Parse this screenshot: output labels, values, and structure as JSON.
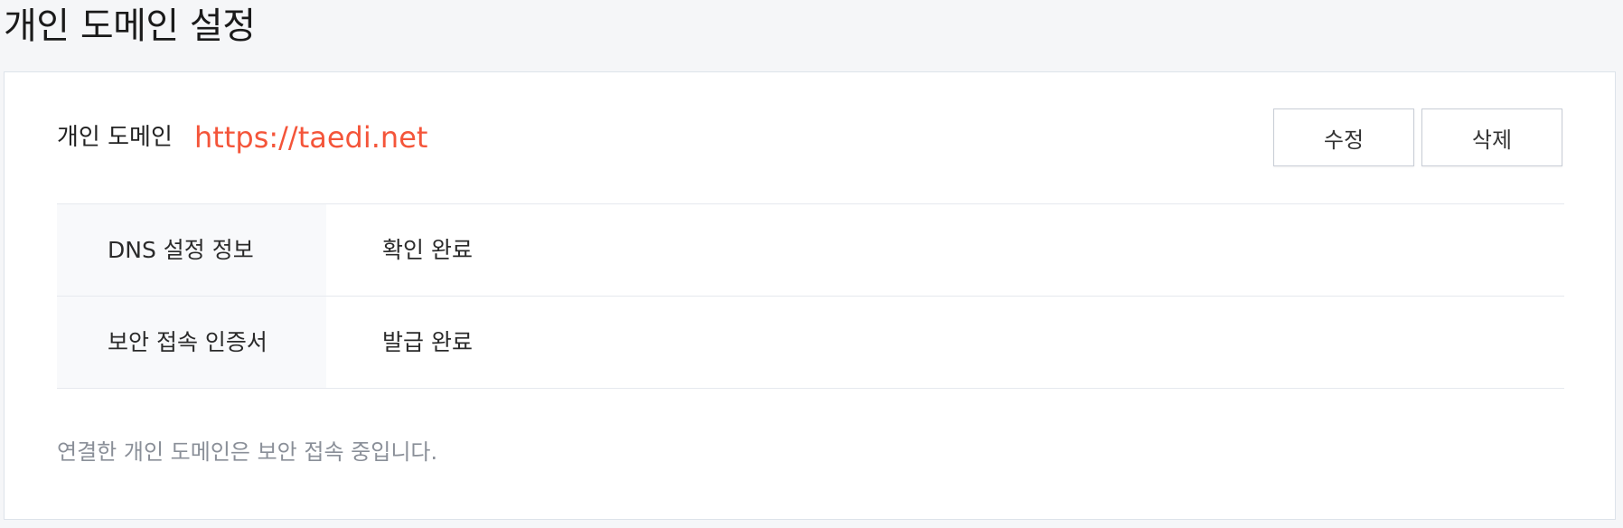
{
  "page": {
    "title": "개인 도메인 설정"
  },
  "domain": {
    "label": "개인 도메인",
    "url": "https://taedi.net",
    "url_color": "#f4553a"
  },
  "actions": {
    "edit_label": "수정",
    "delete_label": "삭제"
  },
  "info_rows": [
    {
      "label": "DNS 설정 정보",
      "value": "확인 완료"
    },
    {
      "label": "보안 접속 인증서",
      "value": "발급 완료"
    }
  ],
  "footer": {
    "note": "연결한 개인 도메인은 보안 접속 중입니다."
  }
}
